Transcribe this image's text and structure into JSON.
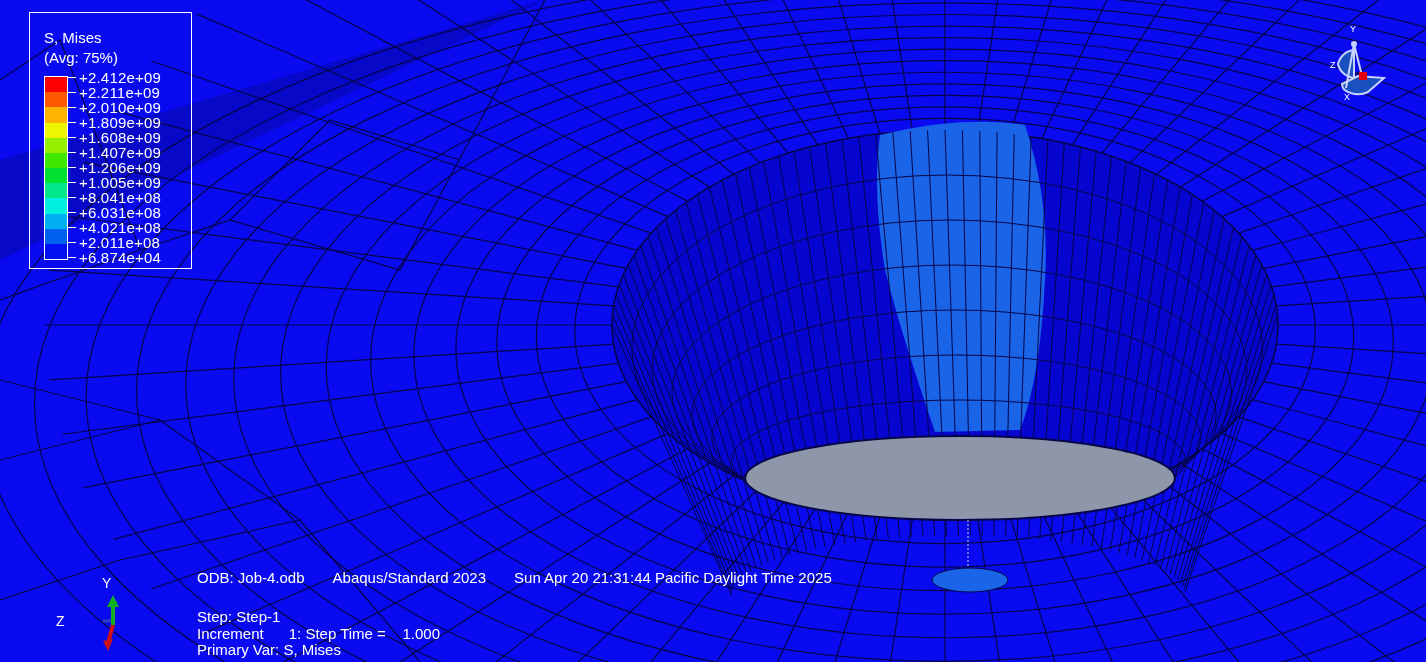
{
  "legend": {
    "title": "S, Mises",
    "subtitle": "(Avg: 75%)",
    "bands": [
      {
        "color": "#ff0000"
      },
      {
        "color": "#ff5a00"
      },
      {
        "color": "#ffb400"
      },
      {
        "color": "#eef500"
      },
      {
        "color": "#94f000"
      },
      {
        "color": "#40e800"
      },
      {
        "color": "#00e030"
      },
      {
        "color": "#00e88a"
      },
      {
        "color": "#00f0e0"
      },
      {
        "color": "#00b0f0"
      },
      {
        "color": "#0060f0"
      },
      {
        "color": "#0010f0"
      }
    ],
    "labels": [
      "+2.412e+09",
      "+2.211e+09",
      "+2.010e+09",
      "+1.809e+09",
      "+1.608e+09",
      "+1.407e+09",
      "+1.206e+09",
      "+1.005e+09",
      "+8.041e+08",
      "+6.031e+08",
      "+4.021e+08",
      "+2.011e+08",
      "+6.874e+04"
    ]
  },
  "view_triad": {
    "labels": [
      "Y",
      "Z",
      "X"
    ]
  },
  "info": {
    "header": [
      "ODB: Job-4.odb",
      "Abaqus/Standard 2023",
      "Sun Apr 20 21:31:44 Pacific Daylight Time 2025"
    ],
    "lines": [
      "Step: Step-1",
      "Increment      1: Step Time =    1.000",
      "Primary Var: S, Mises"
    ]
  },
  "axis_triad": {
    "labels": [
      "Y",
      "Z"
    ]
  }
}
